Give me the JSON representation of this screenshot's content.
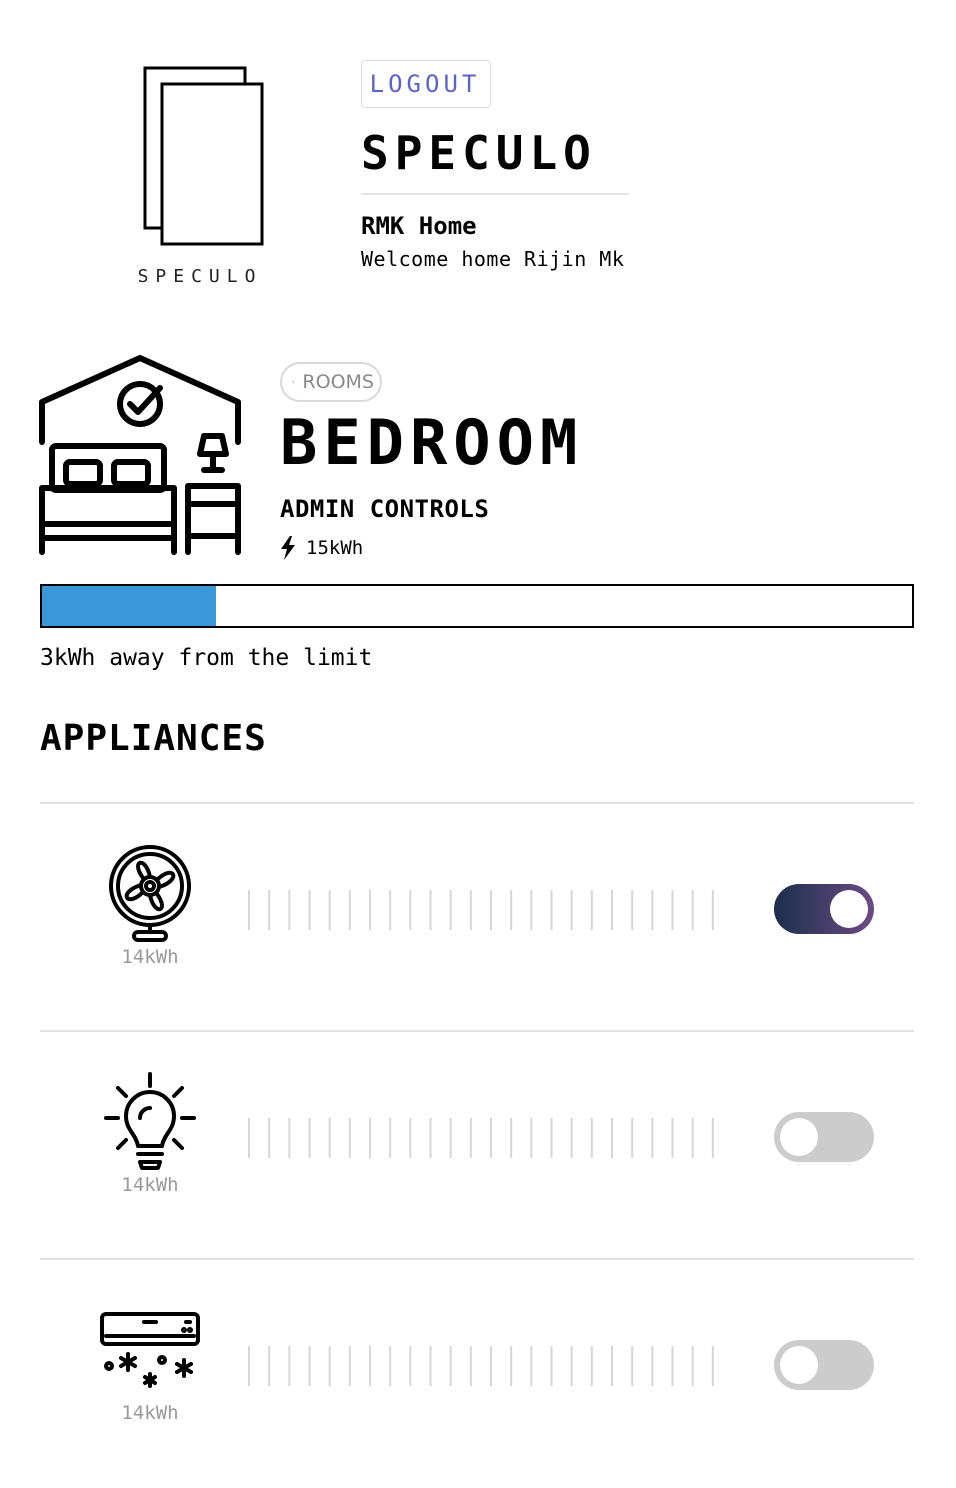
{
  "header": {
    "logo_text": "SPECULO",
    "logout_label": "LOGOUT",
    "brand_title": "SPECULO",
    "home_name": "RMK Home",
    "welcome": "Welcome home Rijin Mk"
  },
  "room": {
    "back_label": "ROOMS",
    "title": "BEDROOM",
    "subtitle": "ADMIN CONTROLS",
    "usage": "15kWh",
    "progress_fraction": 0.2,
    "limit_text": "3kWh away from the limit"
  },
  "appliances": {
    "title": "APPLIANCES",
    "items": [
      {
        "icon": "fan-icon",
        "usage": "14kWh",
        "enabled": true
      },
      {
        "icon": "bulb-icon",
        "usage": "14kWh",
        "enabled": false
      },
      {
        "icon": "air-conditioner-icon",
        "usage": "14kWh",
        "enabled": false
      }
    ]
  },
  "colors": {
    "accent_blue": "#3a98d8",
    "logout_text": "#5a63cc",
    "toggle_on_start": "#1b2f4a",
    "toggle_on_end": "#6d4b86",
    "toggle_off": "#cccccc"
  }
}
